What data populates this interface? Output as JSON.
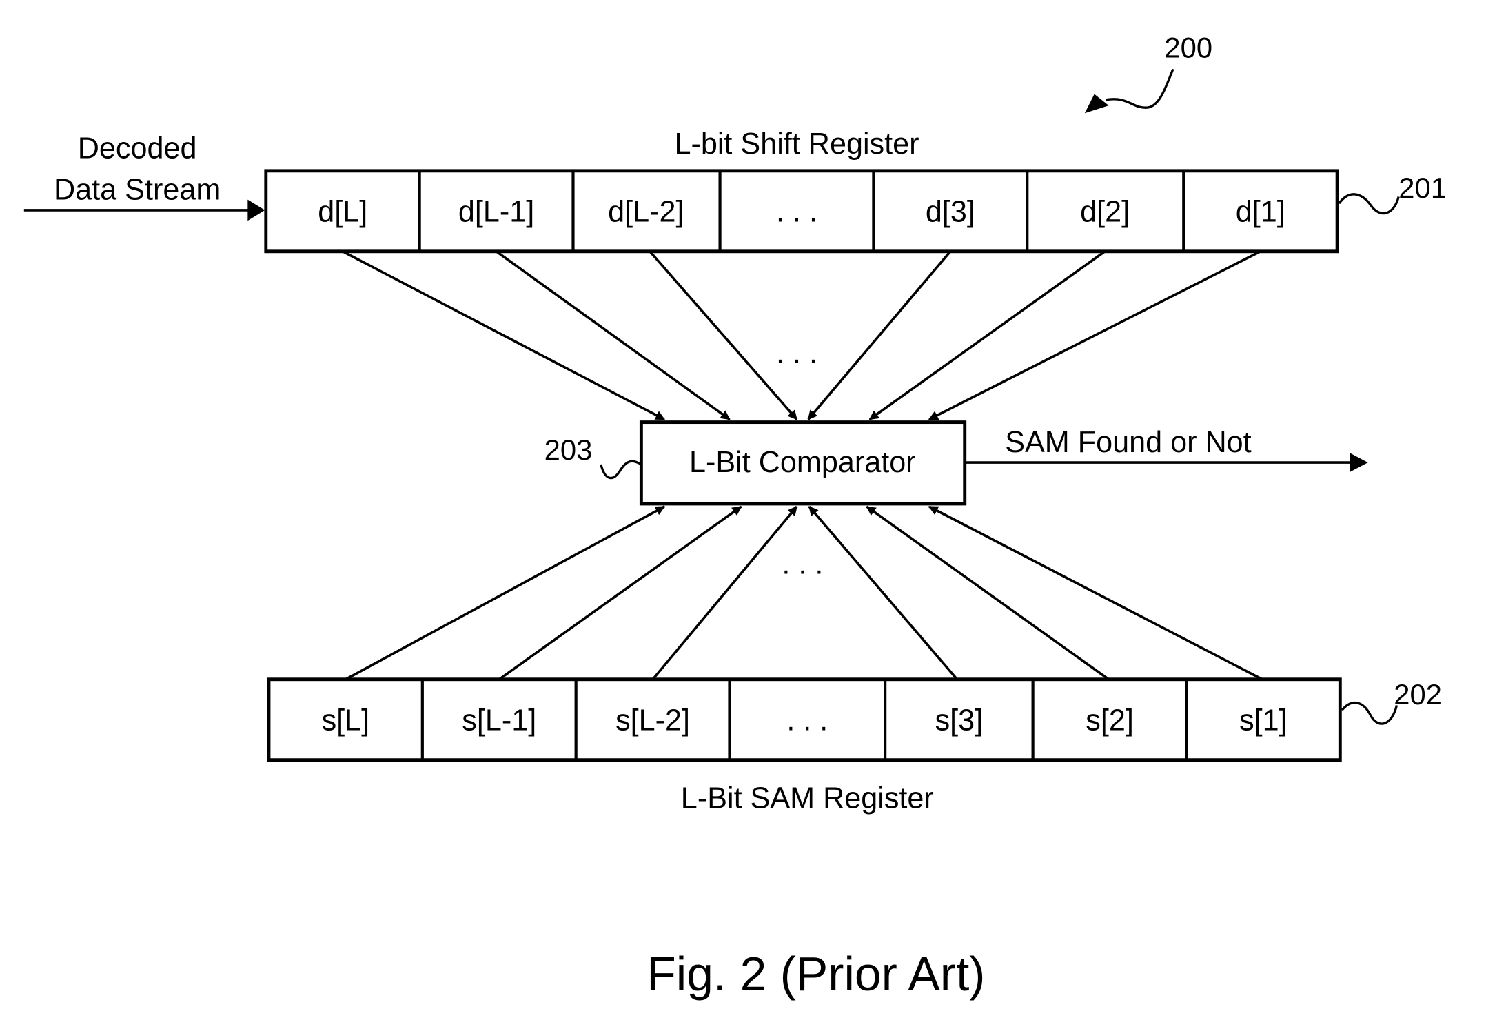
{
  "figure": {
    "reference_number": "200",
    "caption": "Fig. 2 (Prior Art)"
  },
  "input": {
    "label_line1": "Decoded",
    "label_line2": "Data Stream"
  },
  "shift_register": {
    "title": "L-bit  Shift Register",
    "reference_number": "201",
    "cells": [
      "d[L]",
      "d[L-1]",
      "d[L-2]",
      ". . .",
      "d[3]",
      "d[2]",
      "d[1]"
    ]
  },
  "comparator": {
    "label": "L-Bit Comparator",
    "reference_number": "203",
    "output_label": "SAM Found or Not"
  },
  "sam_register": {
    "title": "L-Bit SAM Register",
    "reference_number": "202",
    "cells": [
      "s[L]",
      "s[L-1]",
      "s[L-2]",
      ". . .",
      "s[3]",
      "s[2]",
      "s[1]"
    ]
  },
  "ellipsis": {
    "upper": ". . .",
    "lower": ". . ."
  }
}
